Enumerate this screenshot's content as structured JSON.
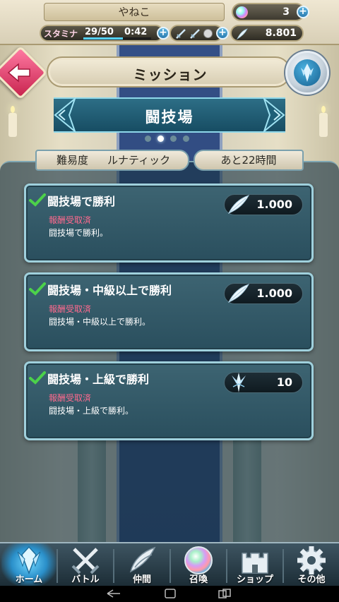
{
  "player": {
    "name": "やねこ",
    "orbs": "3",
    "stamina_label": "スタミナ",
    "stamina": "29/50",
    "stamina_fraction": 0.58,
    "stamina_timer": "0:42",
    "feathers": "8.801"
  },
  "header": {
    "title": "ミッション"
  },
  "category": {
    "title": "闘技場",
    "page_index": 1,
    "page_count": 4
  },
  "info": {
    "difficulty_label": "難易度",
    "difficulty_value": "ルナティック",
    "time_left": "あと22時間"
  },
  "missions": [
    {
      "title": "闘技場で勝利",
      "status": "報酬受取済",
      "desc": "闘技場で勝利。",
      "reward_icon": "feather-icon",
      "reward": "1.000"
    },
    {
      "title": "闘技場・中級以上で勝利",
      "status": "報酬受取済",
      "desc": "闘技場・中級以上で勝利。",
      "reward_icon": "feather-icon",
      "reward": "1.000"
    },
    {
      "title": "闘技場・上級で勝利",
      "status": "報酬受取済",
      "desc": "闘技場・上級で勝利。",
      "reward_icon": "dueling-crest-icon",
      "reward": "10"
    }
  ],
  "nav": [
    {
      "label": "ホーム",
      "icon": "home-crest-icon",
      "active": true
    },
    {
      "label": "バトル",
      "icon": "crossed-swords-icon",
      "active": false
    },
    {
      "label": "仲間",
      "icon": "wing-icon",
      "active": false
    },
    {
      "label": "召喚",
      "icon": "orb-icon",
      "active": false
    },
    {
      "label": "ショップ",
      "icon": "castle-icon",
      "active": false
    },
    {
      "label": "その他",
      "icon": "gear-icon",
      "active": false
    }
  ],
  "colors": {
    "status_text": "#ff6a8e",
    "check": "#4cd14a",
    "active_nav": "#2a8fc9",
    "back_button": "#c8244f"
  }
}
